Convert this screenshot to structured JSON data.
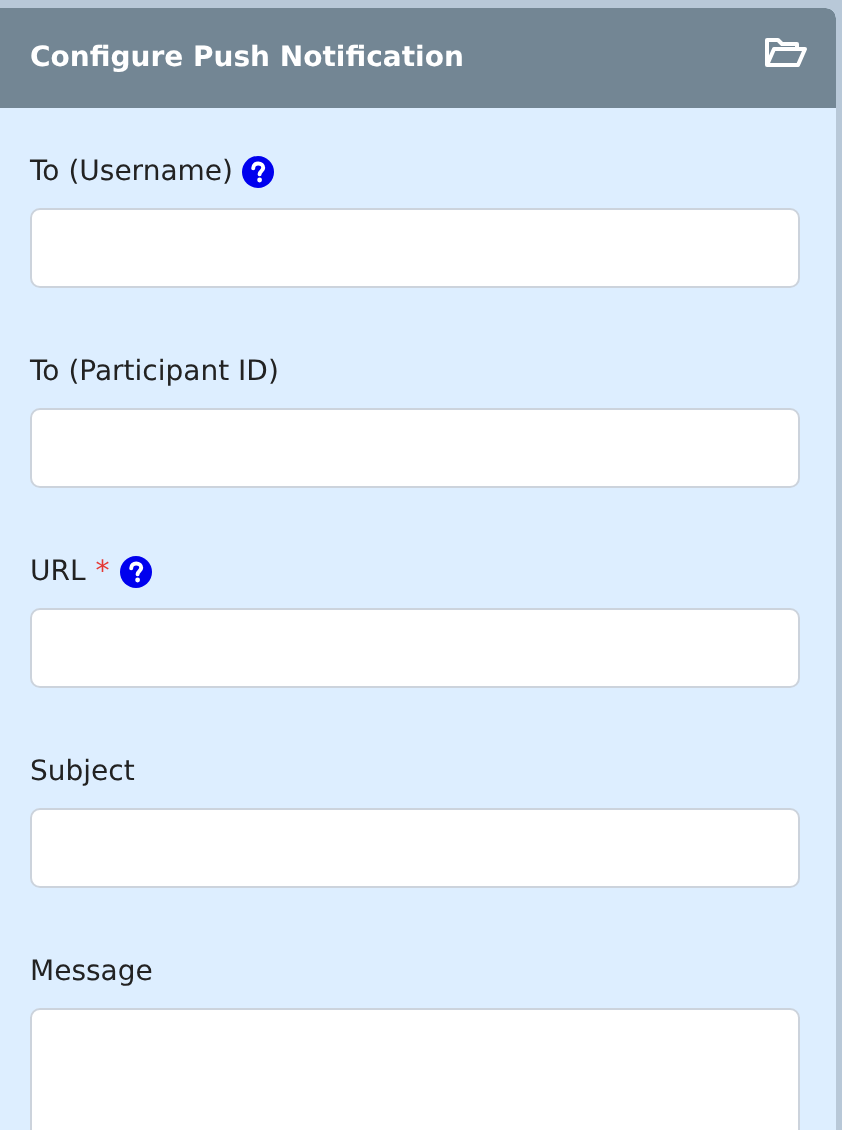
{
  "panel": {
    "title": "Configure Push Notification"
  },
  "fields": [
    {
      "label": "To (Username)",
      "kind": "input",
      "help": true
    },
    {
      "label": "To (Participant ID)",
      "kind": "input",
      "help": false
    },
    {
      "label": "URL",
      "kind": "input",
      "required_mark": "*",
      "help": true
    },
    {
      "label": "Subject",
      "kind": "input",
      "help": false
    },
    {
      "label": "Message",
      "kind": "textarea",
      "help": false
    }
  ]
}
